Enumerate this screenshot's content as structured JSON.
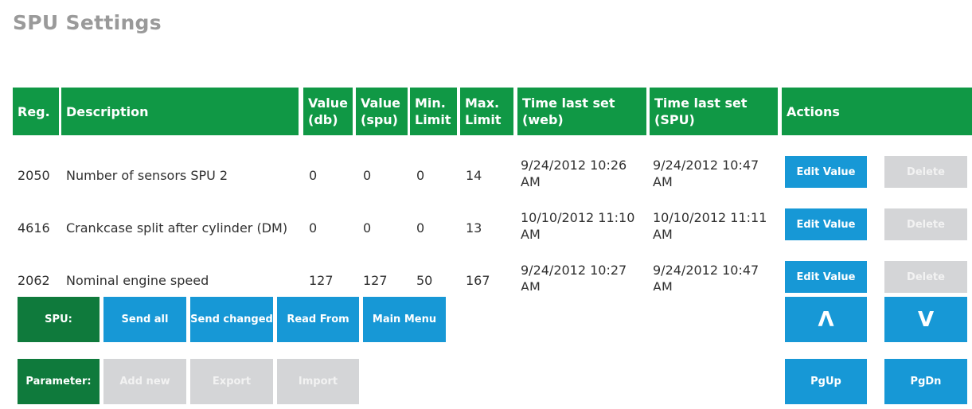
{
  "page": {
    "title": "SPU Settings"
  },
  "table": {
    "headers": {
      "reg": "Reg.",
      "description": "Description",
      "value_db": [
        "Value",
        "(db)"
      ],
      "value_spu": [
        "Value",
        "(spu)"
      ],
      "min_limit": [
        "Min.",
        "Limit"
      ],
      "max_limit": [
        "Max.",
        "Limit"
      ],
      "time_web": [
        "Time last set",
        "(web)"
      ],
      "time_spu": [
        "Time last set",
        "(SPU)"
      ],
      "actions": "Actions"
    },
    "rows": [
      {
        "reg": "2050",
        "description": "Number of sensors SPU 2",
        "value_db": "0",
        "value_spu": "0",
        "min": "0",
        "max": "14",
        "time_web": [
          "9/24/2012 10:26",
          "AM"
        ],
        "time_spu": [
          "9/24/2012 10:47",
          "AM"
        ],
        "edit_label": "Edit Value",
        "delete_label": "Delete"
      },
      {
        "reg": "4616",
        "description": "Crankcase split after cylinder (DM)",
        "value_db": "0",
        "value_spu": "0",
        "min": "0",
        "max": "13",
        "time_web": [
          "10/10/2012 11:10",
          "AM"
        ],
        "time_spu": [
          "10/10/2012 11:11",
          "AM"
        ],
        "edit_label": "Edit Value",
        "delete_label": "Delete"
      },
      {
        "reg": "2062",
        "description": "Nominal engine speed",
        "value_db": "127",
        "value_spu": "127",
        "min": "50",
        "max": "167",
        "time_web": [
          "9/24/2012 10:27",
          "AM"
        ],
        "time_spu": [
          "9/24/2012 10:47",
          "AM"
        ],
        "edit_label": "Edit Value",
        "delete_label": "Delete"
      }
    ]
  },
  "spu_toolbar": {
    "label": "SPU:",
    "send_all": "Send all",
    "send_changed": "Send changed",
    "read_from": "Read From",
    "main_menu": "Main Menu"
  },
  "parameter_toolbar": {
    "label": "Parameter:",
    "add_new": "Add new",
    "export": "Export",
    "import": "Import"
  },
  "navigation": {
    "up_icon": "chevron-up-icon",
    "up_glyph": "Λ",
    "down_icon": "chevron-down-icon",
    "down_glyph": "V",
    "page_up": "PgUp",
    "page_down": "PgDn"
  },
  "colors": {
    "header_green": "#109845",
    "label_green": "#0f7a3c",
    "button_blue": "#1798d6",
    "disabled_gray": "#d4d5d7",
    "title_gray": "#9a9a9a"
  }
}
